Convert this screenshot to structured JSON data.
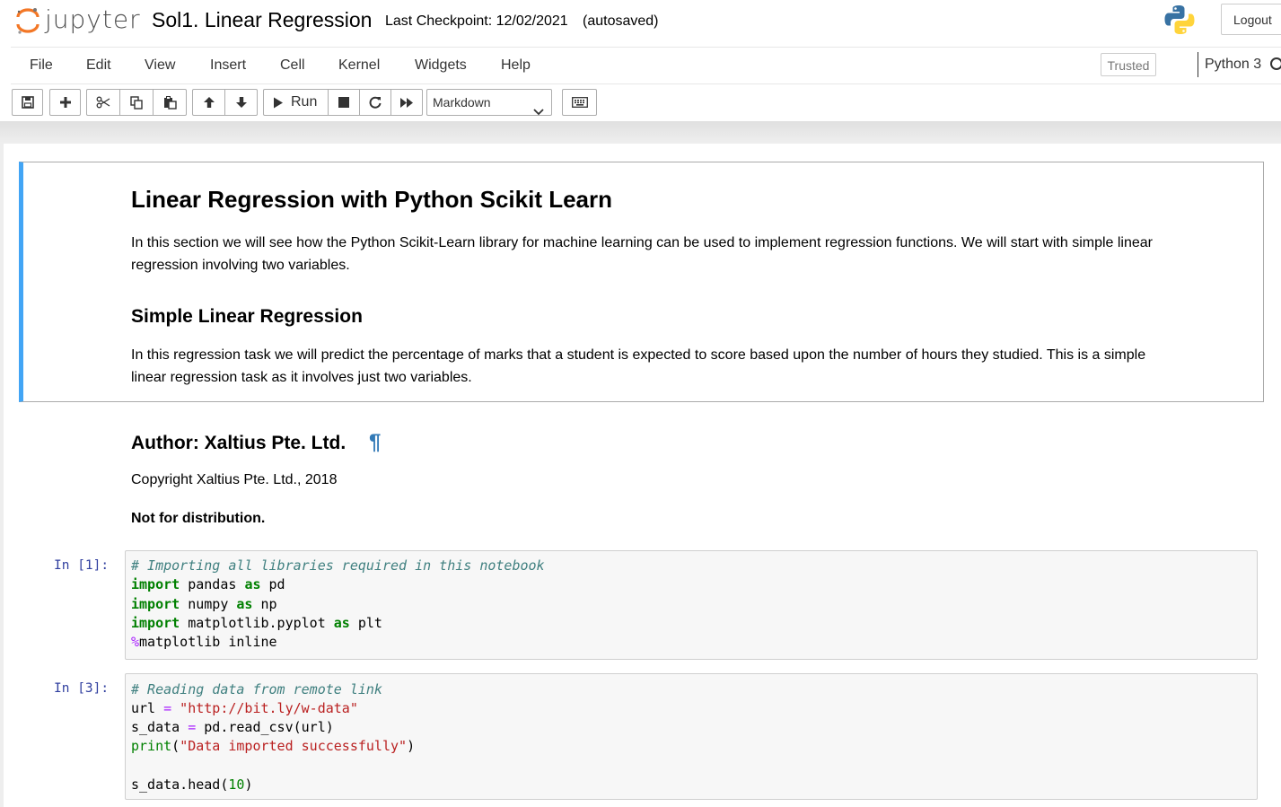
{
  "header": {
    "logo_text": "jupyter",
    "notebook_title": "Sol1. Linear Regression",
    "checkpoint": "Last Checkpoint: 12/02/2021",
    "autosave": "(autosaved)",
    "logout_label": "Logout"
  },
  "menubar": {
    "items": [
      "File",
      "Edit",
      "View",
      "Insert",
      "Cell",
      "Kernel",
      "Widgets",
      "Help"
    ],
    "trusted_label": "Trusted",
    "kernel_name": "Python 3"
  },
  "toolbar": {
    "run_label": "Run",
    "cell_type": "Markdown",
    "icons": [
      "save-icon",
      "plus-icon",
      "cut-icon",
      "copy-icon",
      "paste-icon",
      "arrow-up-icon",
      "arrow-down-icon",
      "run-icon",
      "stop-icon",
      "restart-icon",
      "fast-forward-icon",
      "keyboard-icon"
    ]
  },
  "cells": {
    "md1": {
      "heading": "Linear Regression with Python Scikit Learn",
      "para1_line1": "In this section we will see how the Python Scikit-Learn library for machine learning can be used to implement regression functions. We will start with simple linear",
      "para1_line2": "regression involving two variables.",
      "subheading": "Simple Linear Regression",
      "para2_line1": "In this regression task we will predict the percentage of marks that a student is expected to score based upon the number of hours they studied. This is a simple",
      "para2_line2": "linear regression task as it involves just two variables."
    },
    "md2": {
      "heading": "Author: Xaltius Pte. Ltd.",
      "anchor": "¶",
      "copyright": "Copyright Xaltius Pte. Ltd., 2018",
      "notice": "Not for distribution."
    },
    "code1": {
      "prompt": "In [1]:",
      "comment": "# Importing all libraries required in this notebook",
      "l2_mod": " pandas ",
      "l2_alias": " pd",
      "l3_mod": " numpy ",
      "l3_alias": " np",
      "l4_mod": " matplotlib.pyplot ",
      "l4_alias": " plt",
      "kw_import": "import",
      "kw_as": "as",
      "magic_pct": "%",
      "magic_rest": "matplotlib inline"
    },
    "code2": {
      "prompt": "In [3]:",
      "comment": "# Reading data from remote link",
      "l2_var": "url ",
      "l2_eq": "=",
      "l2_str": " \"http://bit.ly/w-data\"",
      "l3_var": "s_data ",
      "l3_eq": "=",
      "l3_rest": " pd.read_csv(url)",
      "l4_fn": "print",
      "l4_open": "(",
      "l4_str": "\"Data imported successfully\"",
      "l4_close": ")",
      "l6_pre": "s_data.head(",
      "l6_num": "10",
      "l6_post": ")"
    }
  }
}
